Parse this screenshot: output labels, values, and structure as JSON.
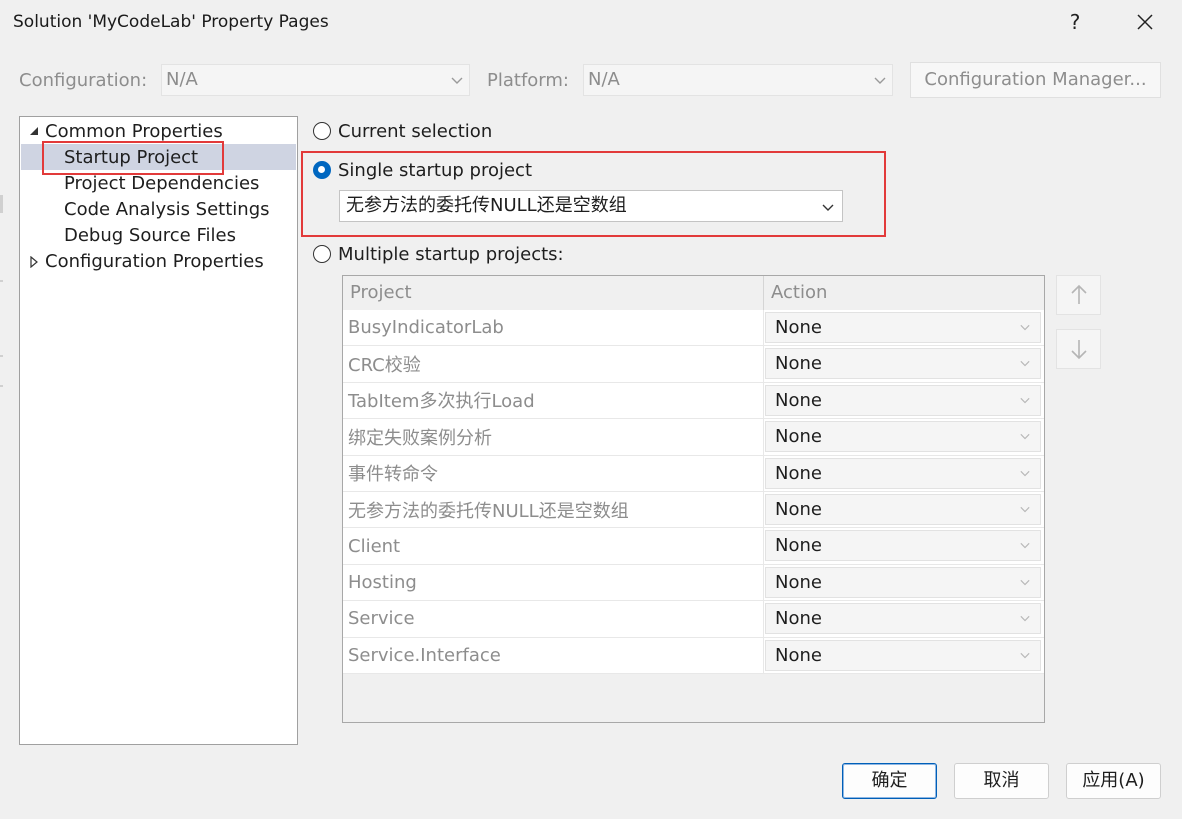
{
  "window": {
    "title": "Solution 'MyCodeLab' Property Pages",
    "help_glyph": "?"
  },
  "config": {
    "configuration_label": "Configuration:",
    "configuration_value": "N/A",
    "platform_label": "Platform:",
    "platform_value": "N/A",
    "manager_label": "Configuration Manager..."
  },
  "tree": {
    "items": [
      {
        "label": "Common Properties",
        "expanded": true
      },
      {
        "label": "Startup Project",
        "selected": true
      },
      {
        "label": "Project Dependencies"
      },
      {
        "label": "Code Analysis Settings"
      },
      {
        "label": "Debug Source Files"
      },
      {
        "label": "Configuration Properties",
        "expanded": false
      }
    ]
  },
  "startup": {
    "current_selection_label": "Current selection",
    "single_startup_label": "Single startup project",
    "single_startup_value": "无参方法的委托传NULL还是空数组",
    "multiple_startup_label": "Multiple startup projects:",
    "selected_option": "single"
  },
  "grid": {
    "headers": {
      "project": "Project",
      "action": "Action"
    },
    "rows": [
      {
        "project": "BusyIndicatorLab",
        "action": "None"
      },
      {
        "project": "CRC校验",
        "action": "None"
      },
      {
        "project": "TabItem多次执行Load",
        "action": "None"
      },
      {
        "project": "绑定失败案例分析",
        "action": "None"
      },
      {
        "project": "事件转命令",
        "action": "None"
      },
      {
        "project": "无参方法的委托传NULL还是空数组",
        "action": "None"
      },
      {
        "project": "Client",
        "action": "None"
      },
      {
        "project": "Hosting",
        "action": "None"
      },
      {
        "project": "Service",
        "action": "None"
      },
      {
        "project": "Service.Interface",
        "action": "None"
      }
    ]
  },
  "buttons": {
    "ok": "确定",
    "cancel": "取消",
    "apply": "应用(A)"
  },
  "colors": {
    "accent": "#0067c0",
    "highlight_border": "#e23a3a",
    "selection_bg": "#cfd4e2"
  }
}
